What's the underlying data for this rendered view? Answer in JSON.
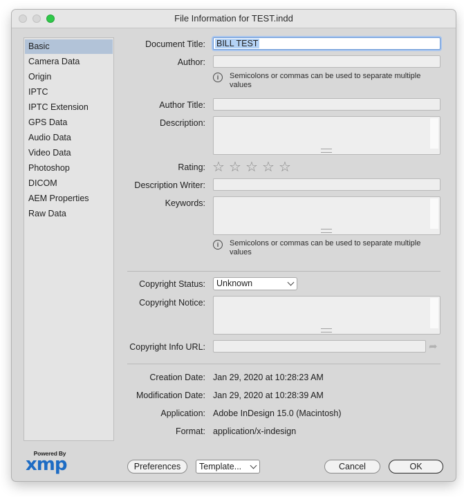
{
  "window": {
    "title": "File Information for TEST.indd",
    "traffic_lights": {
      "close_color": "#d7d7d7",
      "minimize_color": "#d7d7d7",
      "zoom_color": "#2ec949"
    }
  },
  "sidebar": {
    "selected_color": "#b2c3d8",
    "items": [
      {
        "label": "Basic",
        "selected": true
      },
      {
        "label": "Camera Data"
      },
      {
        "label": "Origin"
      },
      {
        "label": "IPTC"
      },
      {
        "label": "IPTC Extension"
      },
      {
        "label": "GPS Data"
      },
      {
        "label": "Audio Data"
      },
      {
        "label": "Video Data"
      },
      {
        "label": "Photoshop"
      },
      {
        "label": "DICOM"
      },
      {
        "label": "AEM Properties"
      },
      {
        "label": "Raw Data"
      }
    ]
  },
  "form": {
    "document_title": {
      "label": "Document Title:",
      "value": "BILL TEST"
    },
    "author": {
      "label": "Author:",
      "value": ""
    },
    "author_hint": "Semicolons or commas can be used to separate multiple values",
    "author_title": {
      "label": "Author Title:",
      "value": ""
    },
    "description": {
      "label": "Description:",
      "value": ""
    },
    "rating": {
      "label": "Rating:",
      "value": 0,
      "max": 5,
      "star_glyph": "☆"
    },
    "description_writer": {
      "label": "Description Writer:",
      "value": ""
    },
    "keywords": {
      "label": "Keywords:",
      "value": ""
    },
    "keywords_hint": "Semicolons or commas can be used to separate multiple values",
    "info_icon_glyph": "i",
    "copyright_status": {
      "label": "Copyright Status:",
      "value": "Unknown"
    },
    "copyright_notice": {
      "label": "Copyright Notice:",
      "value": ""
    },
    "copyright_url": {
      "label": "Copyright Info URL:",
      "value": "",
      "go_icon": "➦"
    }
  },
  "metadata": {
    "creation_date": {
      "label": "Creation Date:",
      "value": "Jan 29, 2020 at 10:28:23 AM"
    },
    "modification_date": {
      "label": "Modification Date:",
      "value": "Jan 29, 2020 at 10:28:39 AM"
    },
    "application": {
      "label": "Application:",
      "value": "Adobe InDesign 15.0 (Macintosh)"
    },
    "format": {
      "label": "Format:",
      "value": "application/x-indesign"
    }
  },
  "footer": {
    "logo_top": "Powered By",
    "logo_main": "xmp",
    "logo_color": "#1d6cc4",
    "preferences_label": "Preferences",
    "template_label": "Template...",
    "cancel_label": "Cancel",
    "ok_label": "OK"
  }
}
